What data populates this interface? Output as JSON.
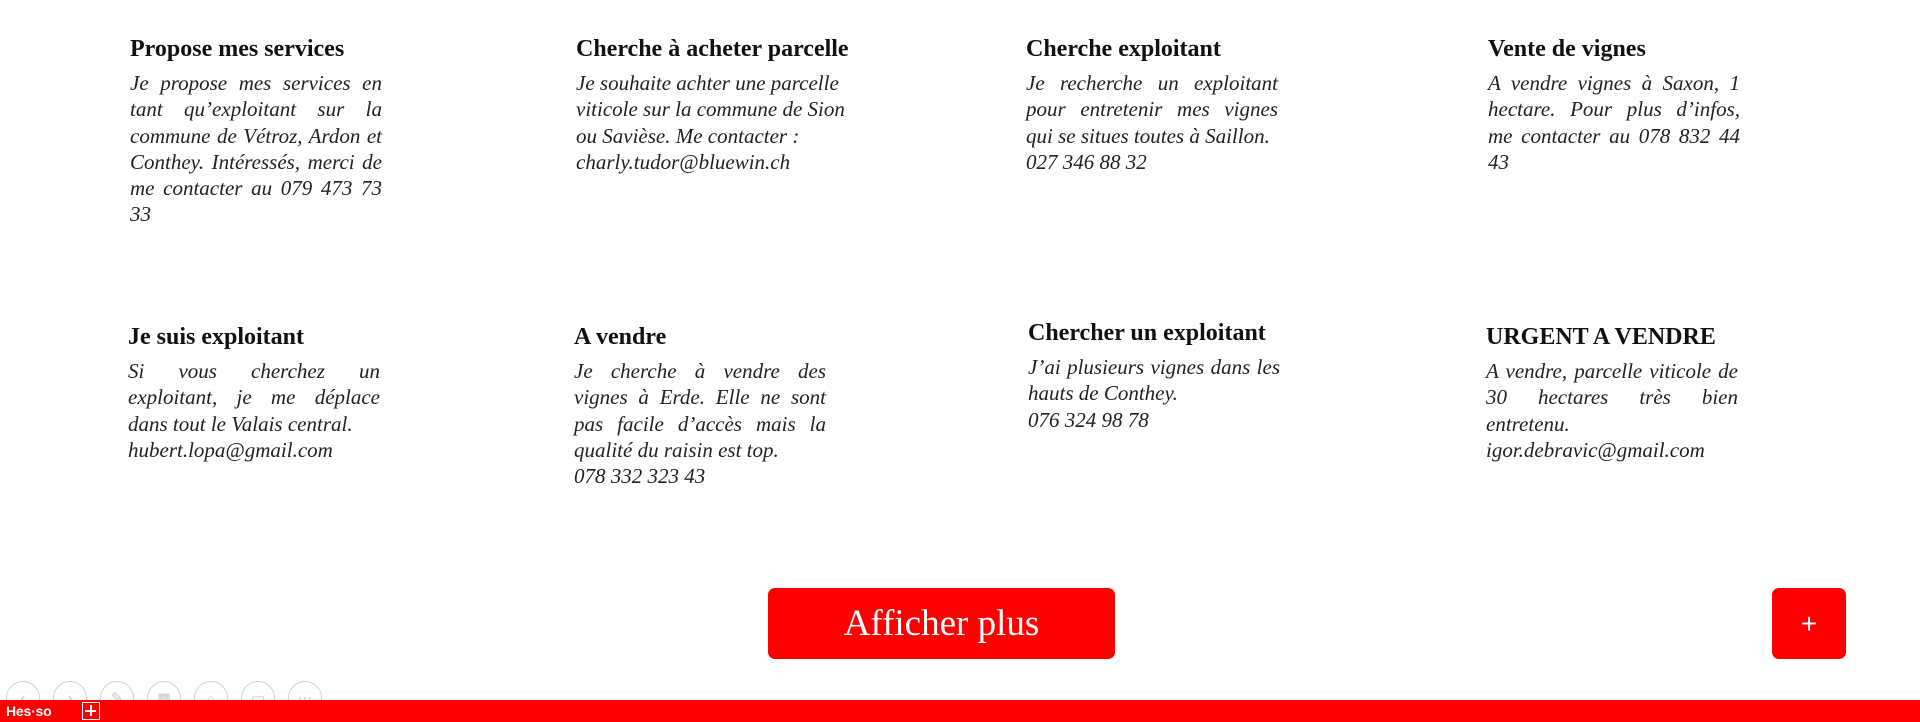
{
  "cards": [
    {
      "title": "Propose mes services",
      "body": [
        "Je propose mes services en tant qu’exploitant sur la commune de Vétroz, Ardon et Conthey. Intéressés, merci de me contacter au 079 473 73 33"
      ]
    },
    {
      "title": "Cherche à acheter parcelle",
      "body": [
        "Je souhaite achter une parcelle viticole sur la commune de Sion ou Savièse. Me contacter :",
        "charly.tudor@bluewin.ch"
      ]
    },
    {
      "title": "Cherche exploitant",
      "body": [
        "Je recherche un exploitant pour entretenir mes vignes qui se situes toutes à Saillon.",
        "027 346 88 32"
      ]
    },
    {
      "title": "Vente de vignes",
      "body": [
        "A vendre vignes à Saxon, 1 hectare. Pour plus d’infos, me contacter au 078 832 44 43"
      ]
    },
    {
      "title": "Je suis exploitant",
      "body": [
        "Si vous cherchez un exploitant, je me déplace dans tout le Valais central.",
        "hubert.lopa@gmail.com"
      ]
    },
    {
      "title": "A vendre",
      "body": [
        "Je cherche à vendre des vignes à Erde. Elle ne sont pas facile d’accès mais la qualité du raisin est top.",
        "078 332 323 43"
      ]
    },
    {
      "title": "Chercher un exploitant",
      "body": [
        "J’ai plusieurs vignes dans les hauts de Conthey.",
        "076 324 98 78"
      ]
    },
    {
      "title": "URGENT A VENDRE",
      "body": [
        "A vendre, parcelle viticole de 30 hectares très bien entretenu.",
        "igor.debravic@gmail.com"
      ]
    }
  ],
  "buttons": {
    "show_more": "Afficher plus",
    "add": "+"
  },
  "footer": {
    "logo_text": "Hes·so",
    "logo_icon": "swiss-cross-icon",
    "bar_color": "#ff0000"
  },
  "slide_controls": [
    {
      "name": "previous-slide-button",
      "glyph": "‹"
    },
    {
      "name": "next-slide-button",
      "glyph": "›"
    },
    {
      "name": "pen-tool-button",
      "glyph": "✎"
    },
    {
      "name": "slides-overview-button",
      "glyph": "▦"
    },
    {
      "name": "zoom-button",
      "glyph": "⌕"
    },
    {
      "name": "screen-button",
      "glyph": "▭"
    },
    {
      "name": "more-options-button",
      "glyph": "⋯"
    }
  ],
  "colors": {
    "accent": "#ff0000",
    "text": "#1a1a1a",
    "background": "#ffffff"
  }
}
